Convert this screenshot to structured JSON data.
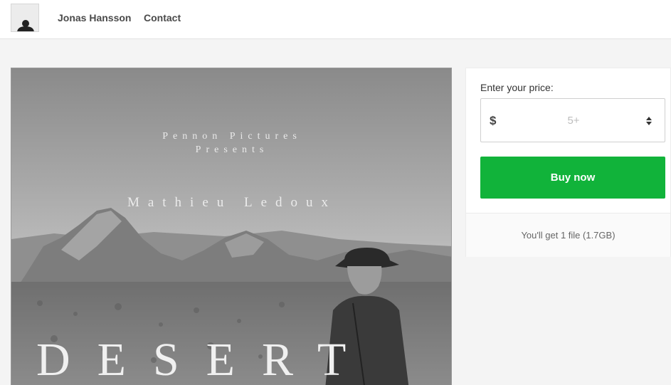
{
  "header": {
    "creator_name": "Jonas Hansson",
    "contact_label": "Contact",
    "avatar_icon": "user-silhouette-icon"
  },
  "cover": {
    "studio_line1": "Pennon Pictures",
    "studio_line2": "Presents",
    "director": "Mathieu Ledoux",
    "title": "DESERT"
  },
  "purchase": {
    "price_label": "Enter your price:",
    "currency_symbol": "$",
    "price_placeholder": "5+",
    "price_value": "",
    "buy_label": "Buy now",
    "file_info": "You'll get 1 file (1.7GB)"
  },
  "colors": {
    "buy_button": "#11b33a",
    "background": "#f4f4f4"
  }
}
